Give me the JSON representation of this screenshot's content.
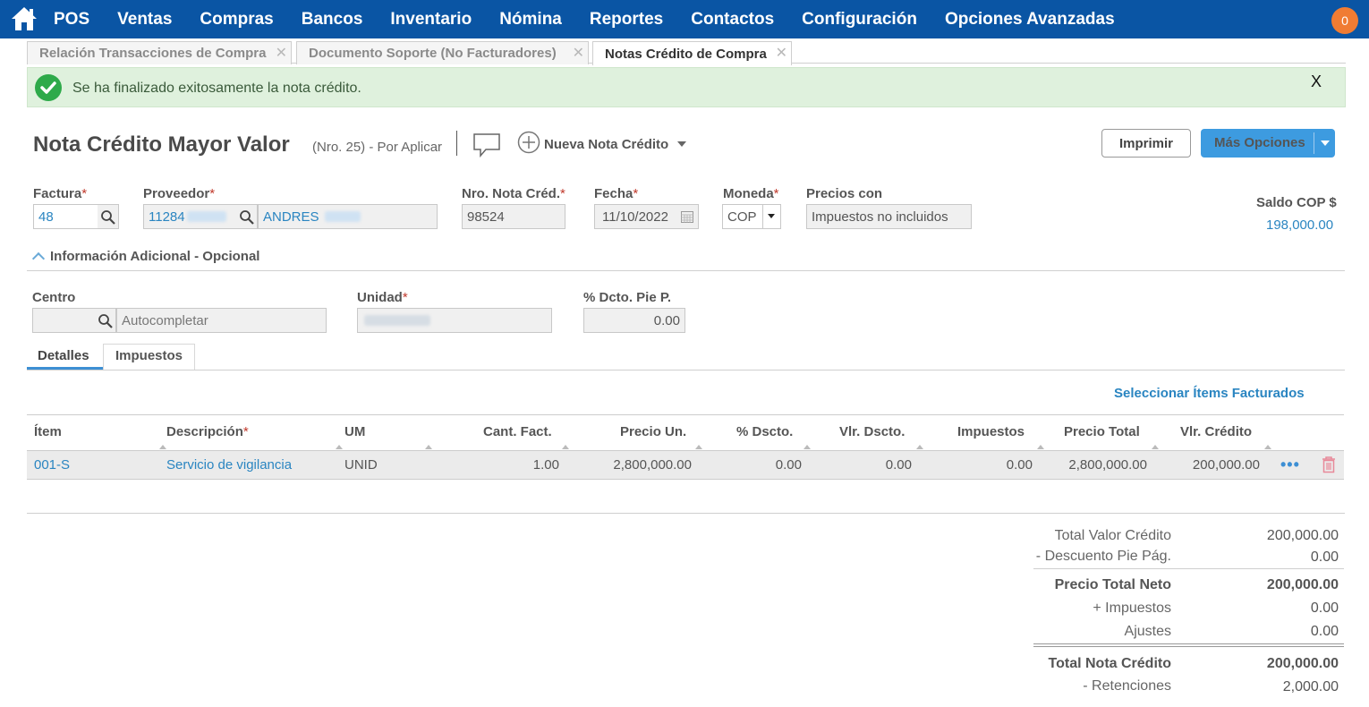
{
  "nav": {
    "items": [
      "POS",
      "Ventas",
      "Compras",
      "Bancos",
      "Inventario",
      "Nómina",
      "Reportes",
      "Contactos",
      "Configuración",
      "Opciones Avanzadas"
    ],
    "notifications": "0"
  },
  "tabs": [
    {
      "label": "Relación Transacciones de Compra"
    },
    {
      "label": "Documento Soporte (No Facturadores)"
    },
    {
      "label": "Notas Crédito de Compra"
    }
  ],
  "alert": {
    "message": "Se ha finalizado exitosamente la nota crédito.",
    "close": "X"
  },
  "header": {
    "title": "Nota Crédito Mayor Valor",
    "subtitle": "(Nro. 25) - Por Aplicar",
    "new_label": "Nueva Nota Crédito",
    "print_label": "Imprimir",
    "more_label": "Más Opciones"
  },
  "form": {
    "factura": {
      "label": "Factura",
      "value": "48"
    },
    "proveedor": {
      "label": "Proveedor",
      "id": "11284",
      "name": "ANDRES"
    },
    "nro_nota": {
      "label": "Nro. Nota Créd.",
      "value": "98524"
    },
    "fecha": {
      "label": "Fecha",
      "value": "11/10/2022"
    },
    "moneda": {
      "label": "Moneda",
      "value": "COP"
    },
    "precios": {
      "label": "Precios con",
      "value": "Impuestos no incluidos"
    },
    "saldo": {
      "label": "Saldo COP $",
      "value": "198,000.00"
    }
  },
  "additional": {
    "title": "Información Adicional - Opcional",
    "centro": {
      "label": "Centro",
      "placeholder": "Autocompletar"
    },
    "unidad": {
      "label": "Unidad"
    },
    "dcto": {
      "label": "% Dcto. Pie P.",
      "value": "0.00"
    }
  },
  "subtabs": {
    "detalles": "Detalles",
    "impuestos": "Impuestos"
  },
  "select_items": "Seleccionar Ítems Facturados",
  "table": {
    "headers": {
      "item": "Ítem",
      "descripcion": "Descripción",
      "um": "UM",
      "cant": "Cant. Fact.",
      "precio_un": "Precio Un.",
      "pct_dscto": "% Dscto.",
      "vlr_dscto": "Vlr. Dscto.",
      "impuestos": "Impuestos",
      "precio_total": "Precio Total",
      "vlr_credito": "Vlr. Crédito"
    },
    "rows": [
      {
        "item": "001-S",
        "descripcion": "Servicio de vigilancia",
        "um": "UNID",
        "cant": "1.00",
        "precio_un": "2,800,000.00",
        "pct_dscto": "0.00",
        "vlr_dscto": "0.00",
        "impuestos": "0.00",
        "precio_total": "2,800,000.00",
        "vlr_credito": "200,000.00"
      }
    ]
  },
  "totals": {
    "total_valor_credito": {
      "label": "Total Valor Crédito",
      "value": "200,000.00"
    },
    "descuento_pie": {
      "label": "- Descuento Pie Pág.",
      "value": "0.00"
    },
    "precio_total_neto": {
      "label": "Precio Total Neto",
      "value": "200,000.00"
    },
    "impuestos": {
      "label": "+ Impuestos",
      "value": "0.00"
    },
    "ajustes": {
      "label": "Ajustes",
      "value": "0.00"
    },
    "total_nota_credito": {
      "label": "Total Nota Crédito",
      "value": "200,000.00"
    },
    "retenciones": {
      "label": "- Retenciones",
      "value": "2,000.00"
    }
  },
  "colors": {
    "nav_bg": "#0a55a4",
    "accent": "#2a85c1",
    "success_bg": "#dff1dd",
    "badge": "#f07c33"
  }
}
